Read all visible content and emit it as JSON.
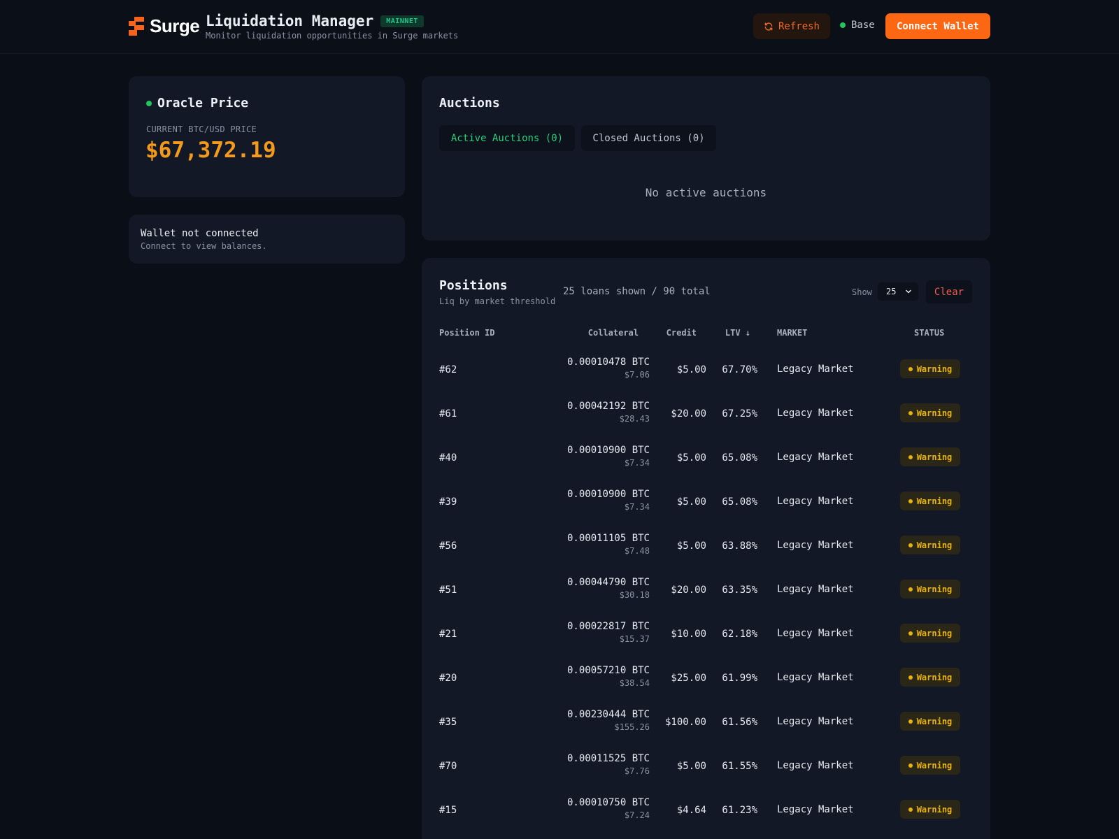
{
  "header": {
    "brand": "Surge",
    "title": "Liquidation Manager",
    "network_badge": "MAINNET",
    "subtitle": "Monitor liquidation opportunities in Surge markets",
    "refresh_label": "Refresh",
    "network_name": "Base",
    "connect_label": "Connect Wallet"
  },
  "oracle": {
    "title": "Oracle Price",
    "caption": "CURRENT BTC/USD PRICE",
    "price": "$67,372.19"
  },
  "wallet": {
    "title": "Wallet not connected",
    "message": "Connect to view balances."
  },
  "auctions": {
    "title": "Auctions",
    "tabs": [
      {
        "label": "Active Auctions (0)",
        "active": true
      },
      {
        "label": "Closed Auctions (0)",
        "active": false
      }
    ],
    "empty_text": "No active auctions"
  },
  "positions": {
    "title": "Positions",
    "subtitle": "Liq by market threshold",
    "count_text": "25 loans shown / 90 total",
    "show_label": "Show",
    "page_size": "25",
    "clear_label": "Clear",
    "columns": [
      "Position ID",
      "Collateral",
      "Credit",
      "LTV ↓",
      "MARKET",
      "STATUS"
    ],
    "rows": [
      {
        "id": "#62",
        "btc": "0.00010478 BTC",
        "usd": "$7.06",
        "credit": "$5.00",
        "ltv": "67.70%",
        "market": "Legacy Market",
        "status": "Warning"
      },
      {
        "id": "#61",
        "btc": "0.00042192 BTC",
        "usd": "$28.43",
        "credit": "$20.00",
        "ltv": "67.25%",
        "market": "Legacy Market",
        "status": "Warning"
      },
      {
        "id": "#40",
        "btc": "0.00010900 BTC",
        "usd": "$7.34",
        "credit": "$5.00",
        "ltv": "65.08%",
        "market": "Legacy Market",
        "status": "Warning"
      },
      {
        "id": "#39",
        "btc": "0.00010900 BTC",
        "usd": "$7.34",
        "credit": "$5.00",
        "ltv": "65.08%",
        "market": "Legacy Market",
        "status": "Warning"
      },
      {
        "id": "#56",
        "btc": "0.00011105 BTC",
        "usd": "$7.48",
        "credit": "$5.00",
        "ltv": "63.88%",
        "market": "Legacy Market",
        "status": "Warning"
      },
      {
        "id": "#51",
        "btc": "0.00044790 BTC",
        "usd": "$30.18",
        "credit": "$20.00",
        "ltv": "63.35%",
        "market": "Legacy Market",
        "status": "Warning"
      },
      {
        "id": "#21",
        "btc": "0.00022817 BTC",
        "usd": "$15.37",
        "credit": "$10.00",
        "ltv": "62.18%",
        "market": "Legacy Market",
        "status": "Warning"
      },
      {
        "id": "#20",
        "btc": "0.00057210 BTC",
        "usd": "$38.54",
        "credit": "$25.00",
        "ltv": "61.99%",
        "market": "Legacy Market",
        "status": "Warning"
      },
      {
        "id": "#35",
        "btc": "0.00230444 BTC",
        "usd": "$155.26",
        "credit": "$100.00",
        "ltv": "61.56%",
        "market": "Legacy Market",
        "status": "Warning"
      },
      {
        "id": "#70",
        "btc": "0.00011525 BTC",
        "usd": "$7.76",
        "credit": "$5.00",
        "ltv": "61.55%",
        "market": "Legacy Market",
        "status": "Warning"
      },
      {
        "id": "#15",
        "btc": "0.00010750 BTC",
        "usd": "$7.24",
        "credit": "$4.64",
        "ltv": "61.23%",
        "market": "Legacy Market",
        "status": "Warning"
      }
    ]
  },
  "colors": {
    "accent": "#fb6712",
    "price": "#f39a1c",
    "success": "#22c55e",
    "warning": "#eab308",
    "danger": "#f0604f"
  },
  "icons": [
    "surge-logo-icon",
    "refresh-icon",
    "status-dot-icon",
    "chevron-down-icon",
    "sort-down-icon"
  ]
}
